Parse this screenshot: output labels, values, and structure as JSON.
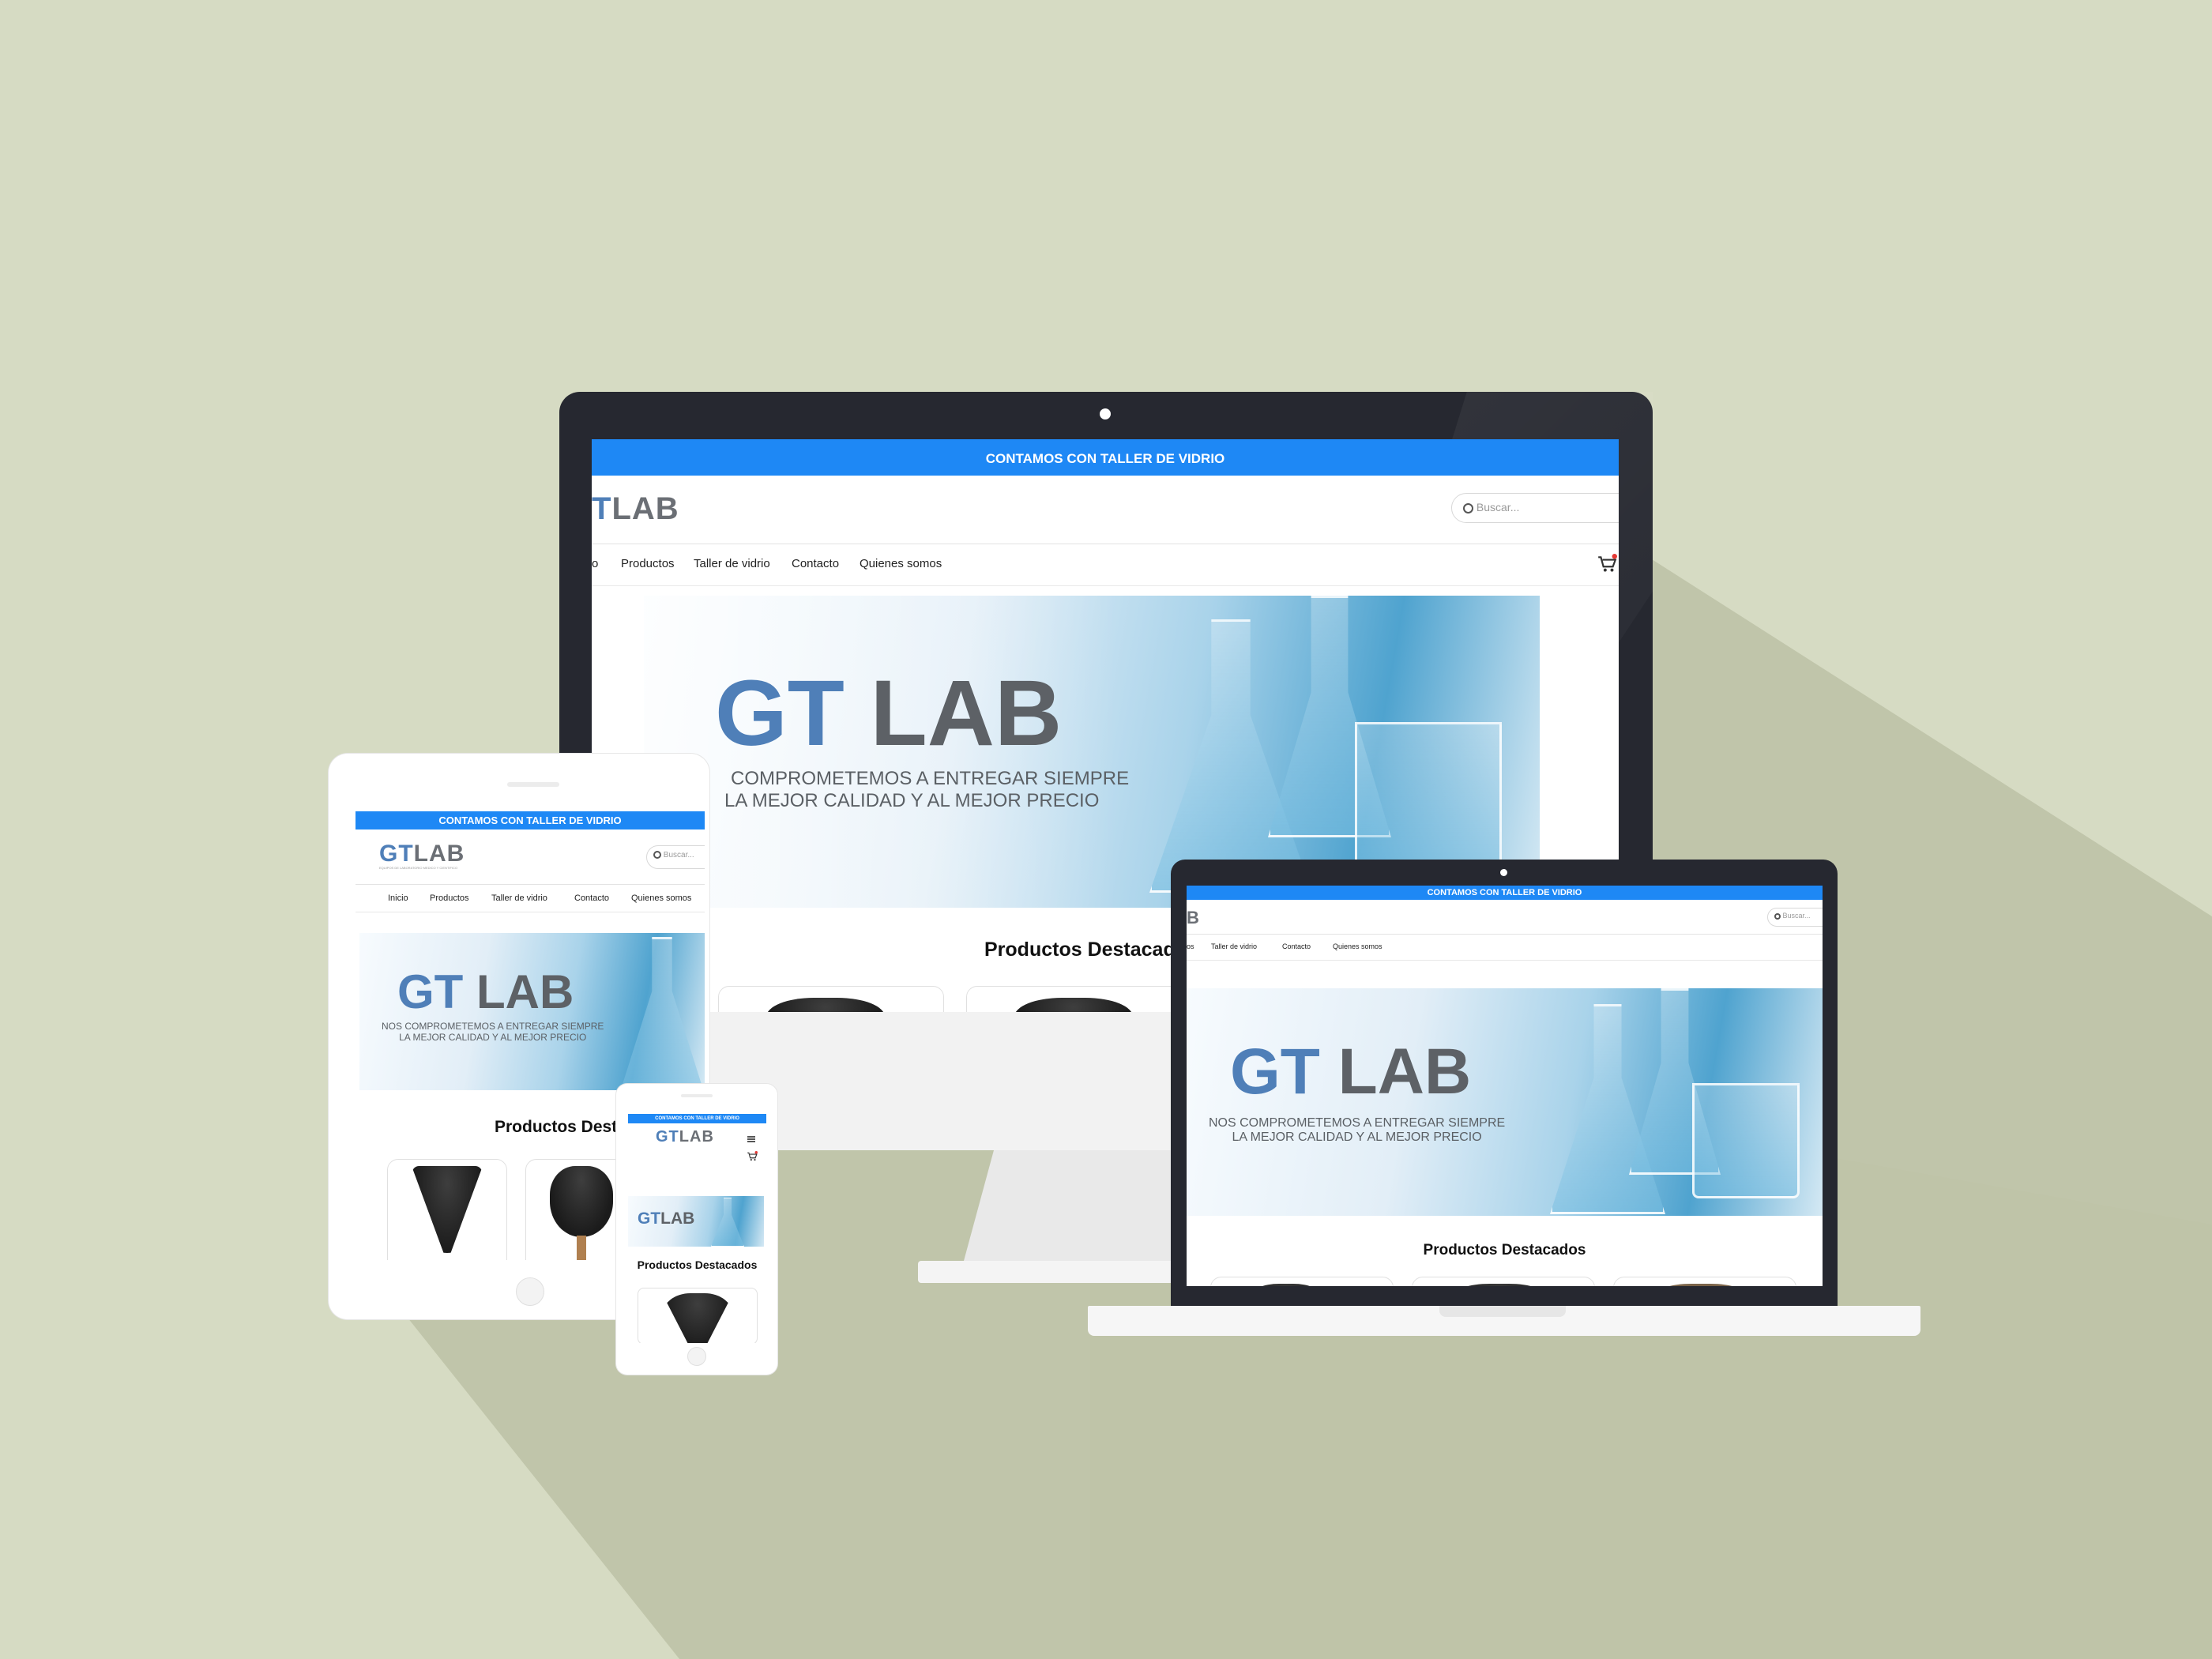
{
  "colors": {
    "background": "#d6dbc3",
    "topbar": "#1e88f5",
    "brand_blue": "#4f7fb8",
    "brand_gray": "#6b6f75",
    "device_dark": "#262830",
    "cart_badge": "#e53935"
  },
  "site": {
    "topbar_text": "CONTAMOS CON TALLER DE VIDRIO",
    "logo_gt": "GT",
    "logo_lab": "LAB",
    "logo_tagline": "EQUIPOS DE LABORATORIO MEDICO Y CIENTIFICO",
    "search_placeholder": "Buscar...",
    "nav": [
      "Inicio",
      "Productos",
      "Taller de vidrio",
      "Contacto",
      "Quienes somos"
    ],
    "banner_gt": "GT",
    "banner_lab": "LAB",
    "banner_line1": "NOS COMPROMETEMOS A ENTREGAR SIEMPRE",
    "banner_line2": "LA MEJOR CALIDAD Y AL MEJOR PRECIO",
    "featured_title": "Productos Destacados"
  },
  "desktop": {
    "logo_partial": "T",
    "nav_partial_first": "o",
    "banner_line1_partial": "COMPROMETEMOS A ENTREGAR SIEMPRE",
    "banner_line2_partial": "LA MEJOR CALIDAD Y AL MEJOR PRECIO",
    "featured_partial": "Productos Destacad"
  },
  "laptop": {
    "logo_partial": "B",
    "nav_partial_first": "os"
  },
  "tablet": {
    "featured_partial": "Productos Dest"
  },
  "phone": {
    "menu_icon": "hamburger-icon"
  },
  "icons": [
    "search-icon",
    "cart-icon",
    "camera-dot-icon",
    "home-button-icon",
    "hamburger-icon"
  ]
}
